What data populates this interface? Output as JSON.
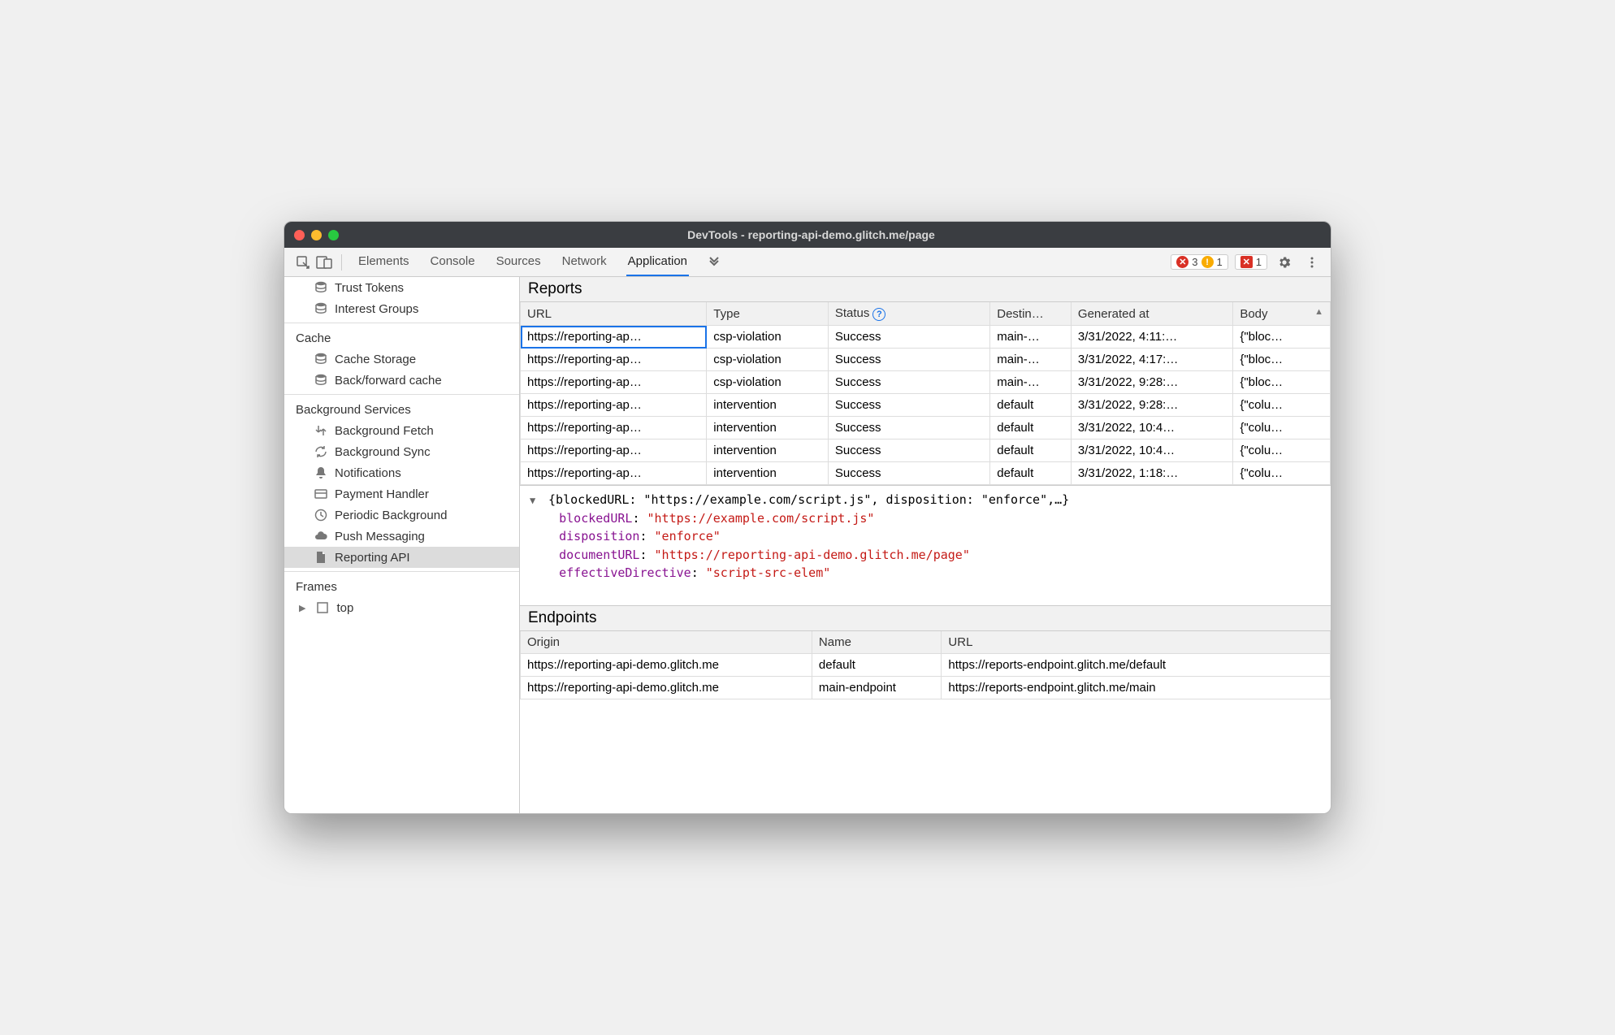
{
  "titlebar": {
    "title": "DevTools - reporting-api-demo.glitch.me/page"
  },
  "toolbar": {
    "tabs": [
      "Elements",
      "Console",
      "Sources",
      "Network",
      "Application"
    ],
    "active_tab": "Application",
    "errors": "3",
    "warnings": "1",
    "issues": "1"
  },
  "sidebar": {
    "top_items": [
      {
        "label": "Trust Tokens",
        "icon": "db-icon"
      },
      {
        "label": "Interest Groups",
        "icon": "db-icon"
      }
    ],
    "sections": [
      {
        "title": "Cache",
        "items": [
          {
            "label": "Cache Storage",
            "icon": "db-icon"
          },
          {
            "label": "Back/forward cache",
            "icon": "db-icon"
          }
        ]
      },
      {
        "title": "Background Services",
        "items": [
          {
            "label": "Background Fetch",
            "icon": "fetch-icon"
          },
          {
            "label": "Background Sync",
            "icon": "sync-icon"
          },
          {
            "label": "Notifications",
            "icon": "bell-icon"
          },
          {
            "label": "Payment Handler",
            "icon": "card-icon"
          },
          {
            "label": "Periodic Background",
            "icon": "clock-icon"
          },
          {
            "label": "Push Messaging",
            "icon": "cloud-icon"
          },
          {
            "label": "Reporting API",
            "icon": "file-icon",
            "selected": true
          }
        ]
      },
      {
        "title": "Frames",
        "items": [
          {
            "label": "top",
            "icon": "frame-icon",
            "expandable": true
          }
        ]
      }
    ]
  },
  "reports": {
    "title": "Reports",
    "columns": [
      "URL",
      "Type",
      "Status",
      "Destin…",
      "Generated at",
      "Body"
    ],
    "sort_col": 5,
    "rows": [
      {
        "url": "https://reporting-ap…",
        "type": "csp-violation",
        "status": "Success",
        "dest": "main-…",
        "time": "3/31/2022, 4:11:…",
        "body": "{\"bloc…",
        "selected": true
      },
      {
        "url": "https://reporting-ap…",
        "type": "csp-violation",
        "status": "Success",
        "dest": "main-…",
        "time": "3/31/2022, 4:17:…",
        "body": "{\"bloc…"
      },
      {
        "url": "https://reporting-ap…",
        "type": "csp-violation",
        "status": "Success",
        "dest": "main-…",
        "time": "3/31/2022, 9:28:…",
        "body": "{\"bloc…"
      },
      {
        "url": "https://reporting-ap…",
        "type": "intervention",
        "status": "Success",
        "dest": "default",
        "time": "3/31/2022, 9:28:…",
        "body": "{\"colu…"
      },
      {
        "url": "https://reporting-ap…",
        "type": "intervention",
        "status": "Success",
        "dest": "default",
        "time": "3/31/2022, 10:4…",
        "body": "{\"colu…"
      },
      {
        "url": "https://reporting-ap…",
        "type": "intervention",
        "status": "Success",
        "dest": "default",
        "time": "3/31/2022, 10:4…",
        "body": "{\"colu…"
      },
      {
        "url": "https://reporting-ap…",
        "type": "intervention",
        "status": "Success",
        "dest": "default",
        "time": "3/31/2022, 1:18:…",
        "body": "{\"colu…"
      }
    ]
  },
  "detail": {
    "summary": "{blockedURL: \"https://example.com/script.js\", disposition: \"enforce\",…}",
    "props": [
      {
        "key": "blockedURL",
        "value": "\"https://example.com/script.js\""
      },
      {
        "key": "disposition",
        "value": "\"enforce\""
      },
      {
        "key": "documentURL",
        "value": "\"https://reporting-api-demo.glitch.me/page\""
      },
      {
        "key": "effectiveDirective",
        "value": "\"script-src-elem\""
      }
    ]
  },
  "endpoints": {
    "title": "Endpoints",
    "columns": [
      "Origin",
      "Name",
      "URL"
    ],
    "rows": [
      {
        "origin": "https://reporting-api-demo.glitch.me",
        "name": "default",
        "url": "https://reports-endpoint.glitch.me/default"
      },
      {
        "origin": "https://reporting-api-demo.glitch.me",
        "name": "main-endpoint",
        "url": "https://reports-endpoint.glitch.me/main"
      }
    ]
  }
}
